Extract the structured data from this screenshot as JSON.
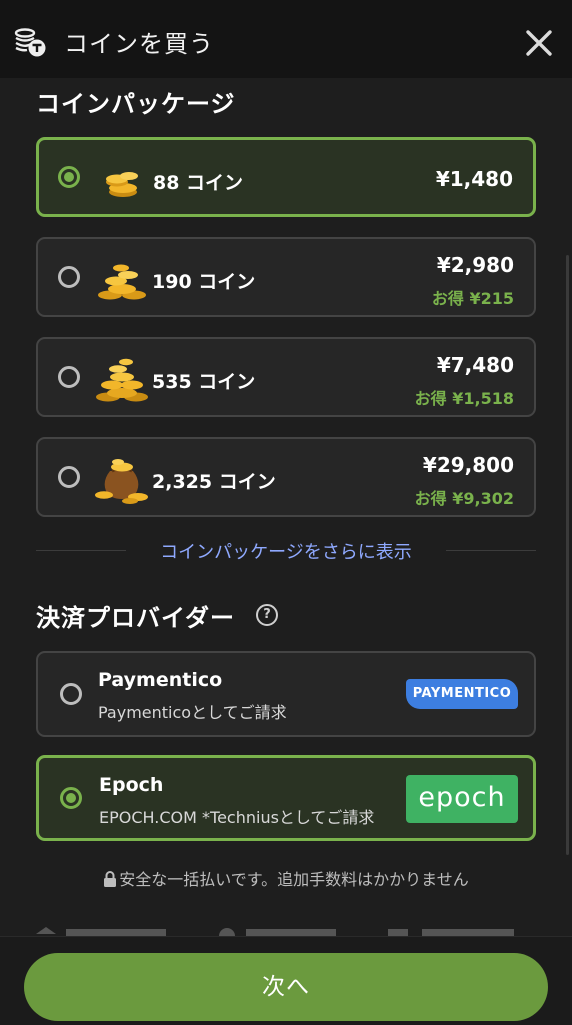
{
  "header": {
    "title": "コインを買う"
  },
  "packages_section": {
    "title": "コインパッケージ"
  },
  "packages": [
    {
      "amount": "88 コイン",
      "price": "¥1,480",
      "savings": "",
      "selected": true
    },
    {
      "amount": "190 コイン",
      "price": "¥2,980",
      "savings": "お得 ¥215",
      "selected": false
    },
    {
      "amount": "535 コイン",
      "price": "¥7,480",
      "savings": "お得 ¥1,518",
      "selected": false
    },
    {
      "amount": "2,325 コイン",
      "price": "¥29,800",
      "savings": "お得 ¥9,302",
      "selected": false
    }
  ],
  "show_more_label": "コインパッケージをさらに表示",
  "providers_section": {
    "title": "決済プロバイダー"
  },
  "providers": [
    {
      "name": "Paymentico",
      "description": "Paymenticoとしてご請求",
      "logo_text": "PAYMENTICO",
      "selected": false
    },
    {
      "name": "Epoch",
      "description": "EPOCH.COM *Techniusとしてご請求",
      "logo_text": "epoch",
      "selected": true
    }
  ],
  "secure_note": "安全な一括払いです。追加手数料はかかりません",
  "next_button": "次へ",
  "colors": {
    "accent": "#7ab24c",
    "button": "#6b9a3e",
    "link": "#8fa9ff",
    "paymentico": "#3d7ee0",
    "epoch": "#3fb263"
  }
}
